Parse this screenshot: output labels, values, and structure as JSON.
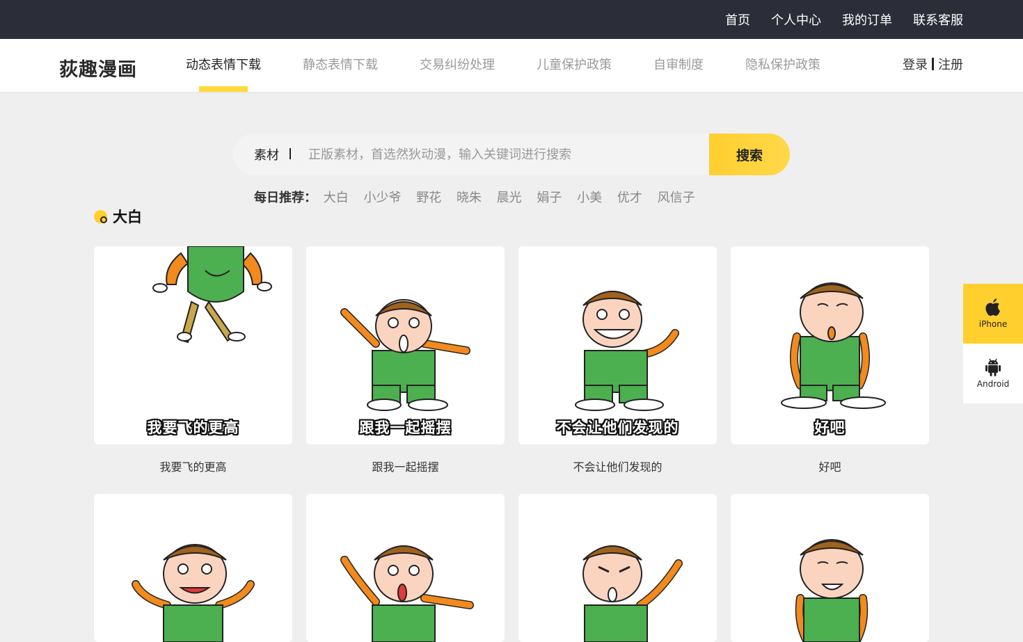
{
  "topbar": {
    "links": [
      "首页",
      "个人中心",
      "我的订单",
      "联系客服"
    ]
  },
  "brand": {
    "logo_text": "荻趣漫画"
  },
  "nav": {
    "items": [
      "动态表情下载",
      "静态表情下载",
      "交易纠纷处理",
      "儿童保护政策",
      "自审制度",
      "隐私保护政策"
    ],
    "active": "动态表情下载"
  },
  "auth": {
    "login": "登录",
    "register": "注册"
  },
  "search": {
    "category": "素材",
    "placeholder": "正版素材，首选然狄动漫，输入关键词进行搜索",
    "button": "搜索"
  },
  "recommend": {
    "label": "每日推荐：",
    "tags": [
      "大白",
      "小少爷",
      "野花",
      "晓朱",
      "晨光",
      "娟子",
      "小美",
      "优才",
      "风信子"
    ]
  },
  "section": {
    "title": "大白"
  },
  "cards": [
    {
      "overlay": "我要飞的更高",
      "label": "我要飞的更高"
    },
    {
      "overlay": "跟我一起摇摆",
      "label": "跟我一起摇摆"
    },
    {
      "overlay": "不会让他们发现的",
      "label": "不会让他们发现的"
    },
    {
      "overlay": "好吧",
      "label": "好吧"
    },
    {
      "overlay": "",
      "label": ""
    },
    {
      "overlay": "",
      "label": ""
    },
    {
      "overlay": "",
      "label": ""
    },
    {
      "overlay": "",
      "label": ""
    }
  ],
  "side_apps": {
    "iphone": "iPhone",
    "android": "Android"
  },
  "colors": {
    "accent": "#ffcf2e",
    "topbar": "#2b2e38",
    "overalls": "#4caf50",
    "shirt": "#f28a1e"
  }
}
